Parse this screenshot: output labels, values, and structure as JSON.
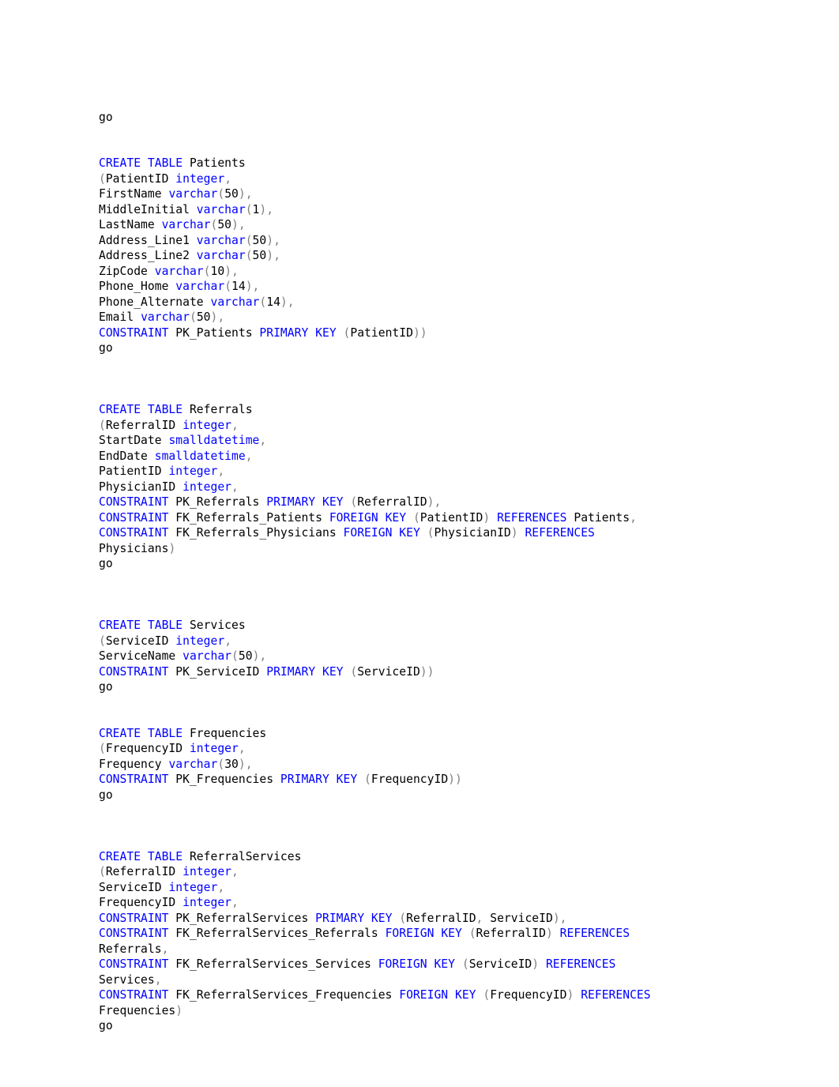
{
  "document": {
    "kind": "sql-script",
    "language": "SQL",
    "page_background": "#ffffff",
    "text_color": "#000000",
    "keyword_color": "#0000ff",
    "punctuation_color": "#808080",
    "tables": [
      "Patients",
      "Referrals",
      "Services",
      "Frequencies",
      "ReferralServices"
    ]
  },
  "code": {
    "lines": [
      [
        {
          "t": "go",
          "c": "plain"
        }
      ],
      [],
      [],
      [
        {
          "t": "CREATE",
          "c": "kw"
        },
        {
          "t": " ",
          "c": "plain"
        },
        {
          "t": "TABLE",
          "c": "kw"
        },
        {
          "t": " Patients",
          "c": "id"
        }
      ],
      [
        {
          "t": "(",
          "c": "pun"
        },
        {
          "t": "PatientID ",
          "c": "id"
        },
        {
          "t": "integer",
          "c": "typ"
        },
        {
          "t": ",",
          "c": "pun"
        }
      ],
      [
        {
          "t": "FirstName ",
          "c": "id"
        },
        {
          "t": "varchar",
          "c": "typ"
        },
        {
          "t": "(",
          "c": "pun"
        },
        {
          "t": "50",
          "c": "num"
        },
        {
          "t": "),",
          "c": "pun"
        }
      ],
      [
        {
          "t": "MiddleInitial ",
          "c": "id"
        },
        {
          "t": "varchar",
          "c": "typ"
        },
        {
          "t": "(",
          "c": "pun"
        },
        {
          "t": "1",
          "c": "num"
        },
        {
          "t": "),",
          "c": "pun"
        }
      ],
      [
        {
          "t": "LastName ",
          "c": "id"
        },
        {
          "t": "varchar",
          "c": "typ"
        },
        {
          "t": "(",
          "c": "pun"
        },
        {
          "t": "50",
          "c": "num"
        },
        {
          "t": "),",
          "c": "pun"
        }
      ],
      [
        {
          "t": "Address_Line1 ",
          "c": "id"
        },
        {
          "t": "varchar",
          "c": "typ"
        },
        {
          "t": "(",
          "c": "pun"
        },
        {
          "t": "50",
          "c": "num"
        },
        {
          "t": "),",
          "c": "pun"
        }
      ],
      [
        {
          "t": "Address_Line2 ",
          "c": "id"
        },
        {
          "t": "varchar",
          "c": "typ"
        },
        {
          "t": "(",
          "c": "pun"
        },
        {
          "t": "50",
          "c": "num"
        },
        {
          "t": "),",
          "c": "pun"
        }
      ],
      [
        {
          "t": "ZipCode ",
          "c": "id"
        },
        {
          "t": "varchar",
          "c": "typ"
        },
        {
          "t": "(",
          "c": "pun"
        },
        {
          "t": "10",
          "c": "num"
        },
        {
          "t": "),",
          "c": "pun"
        }
      ],
      [
        {
          "t": "Phone_Home ",
          "c": "id"
        },
        {
          "t": "varchar",
          "c": "typ"
        },
        {
          "t": "(",
          "c": "pun"
        },
        {
          "t": "14",
          "c": "num"
        },
        {
          "t": "),",
          "c": "pun"
        }
      ],
      [
        {
          "t": "Phone_Alternate ",
          "c": "id"
        },
        {
          "t": "varchar",
          "c": "typ"
        },
        {
          "t": "(",
          "c": "pun"
        },
        {
          "t": "14",
          "c": "num"
        },
        {
          "t": "),",
          "c": "pun"
        }
      ],
      [
        {
          "t": "Email ",
          "c": "id"
        },
        {
          "t": "varchar",
          "c": "typ"
        },
        {
          "t": "(",
          "c": "pun"
        },
        {
          "t": "50",
          "c": "num"
        },
        {
          "t": "),",
          "c": "pun"
        }
      ],
      [
        {
          "t": "CONSTRAINT",
          "c": "kw"
        },
        {
          "t": " PK_Patients ",
          "c": "id"
        },
        {
          "t": "PRIMARY",
          "c": "kw"
        },
        {
          "t": " ",
          "c": "plain"
        },
        {
          "t": "KEY",
          "c": "kw"
        },
        {
          "t": " ",
          "c": "plain"
        },
        {
          "t": "(",
          "c": "pun"
        },
        {
          "t": "PatientID",
          "c": "id"
        },
        {
          "t": "))",
          "c": "pun"
        }
      ],
      [
        {
          "t": "go",
          "c": "plain"
        }
      ],
      [],
      [],
      [],
      [
        {
          "t": "CREATE",
          "c": "kw"
        },
        {
          "t": " ",
          "c": "plain"
        },
        {
          "t": "TABLE",
          "c": "kw"
        },
        {
          "t": " Referrals",
          "c": "id"
        }
      ],
      [
        {
          "t": "(",
          "c": "pun"
        },
        {
          "t": "ReferralID ",
          "c": "id"
        },
        {
          "t": "integer",
          "c": "typ"
        },
        {
          "t": ",",
          "c": "pun"
        }
      ],
      [
        {
          "t": "StartDate ",
          "c": "id"
        },
        {
          "t": "smalldatetime",
          "c": "typ"
        },
        {
          "t": ",",
          "c": "pun"
        }
      ],
      [
        {
          "t": "EndDate ",
          "c": "id"
        },
        {
          "t": "smalldatetime",
          "c": "typ"
        },
        {
          "t": ",",
          "c": "pun"
        }
      ],
      [
        {
          "t": "PatientID ",
          "c": "id"
        },
        {
          "t": "integer",
          "c": "typ"
        },
        {
          "t": ",",
          "c": "pun"
        }
      ],
      [
        {
          "t": "PhysicianID ",
          "c": "id"
        },
        {
          "t": "integer",
          "c": "typ"
        },
        {
          "t": ",",
          "c": "pun"
        }
      ],
      [
        {
          "t": "CONSTRAINT",
          "c": "kw"
        },
        {
          "t": " PK_Referrals ",
          "c": "id"
        },
        {
          "t": "PRIMARY",
          "c": "kw"
        },
        {
          "t": " ",
          "c": "plain"
        },
        {
          "t": "KEY",
          "c": "kw"
        },
        {
          "t": " ",
          "c": "plain"
        },
        {
          "t": "(",
          "c": "pun"
        },
        {
          "t": "ReferralID",
          "c": "id"
        },
        {
          "t": "),",
          "c": "pun"
        }
      ],
      [
        {
          "t": "CONSTRAINT",
          "c": "kw"
        },
        {
          "t": " FK_Referrals_Patients ",
          "c": "id"
        },
        {
          "t": "FOREIGN",
          "c": "kw"
        },
        {
          "t": " ",
          "c": "plain"
        },
        {
          "t": "KEY",
          "c": "kw"
        },
        {
          "t": " ",
          "c": "plain"
        },
        {
          "t": "(",
          "c": "pun"
        },
        {
          "t": "PatientID",
          "c": "id"
        },
        {
          "t": ")",
          "c": "pun"
        },
        {
          "t": " ",
          "c": "plain"
        },
        {
          "t": "REFERENCES",
          "c": "kw"
        },
        {
          "t": " Patients",
          "c": "id"
        },
        {
          "t": ",",
          "c": "pun"
        }
      ],
      [
        {
          "t": "CONSTRAINT",
          "c": "kw"
        },
        {
          "t": " FK_Referrals_Physicians ",
          "c": "id"
        },
        {
          "t": "FOREIGN",
          "c": "kw"
        },
        {
          "t": " ",
          "c": "plain"
        },
        {
          "t": "KEY",
          "c": "kw"
        },
        {
          "t": " ",
          "c": "plain"
        },
        {
          "t": "(",
          "c": "pun"
        },
        {
          "t": "PhysicianID",
          "c": "id"
        },
        {
          "t": ")",
          "c": "pun"
        },
        {
          "t": " ",
          "c": "plain"
        },
        {
          "t": "REFERENCES",
          "c": "kw"
        }
      ],
      [
        {
          "t": "Physicians",
          "c": "id"
        },
        {
          "t": ")",
          "c": "pun"
        }
      ],
      [
        {
          "t": "go",
          "c": "plain"
        }
      ],
      [],
      [],
      [],
      [
        {
          "t": "CREATE",
          "c": "kw"
        },
        {
          "t": " ",
          "c": "plain"
        },
        {
          "t": "TABLE",
          "c": "kw"
        },
        {
          "t": " Services",
          "c": "id"
        }
      ],
      [
        {
          "t": "(",
          "c": "pun"
        },
        {
          "t": "ServiceID ",
          "c": "id"
        },
        {
          "t": "integer",
          "c": "typ"
        },
        {
          "t": ",",
          "c": "pun"
        }
      ],
      [
        {
          "t": "ServiceName ",
          "c": "id"
        },
        {
          "t": "varchar",
          "c": "typ"
        },
        {
          "t": "(",
          "c": "pun"
        },
        {
          "t": "50",
          "c": "num"
        },
        {
          "t": "),",
          "c": "pun"
        }
      ],
      [
        {
          "t": "CONSTRAINT",
          "c": "kw"
        },
        {
          "t": " PK_ServiceID ",
          "c": "id"
        },
        {
          "t": "PRIMARY",
          "c": "kw"
        },
        {
          "t": " ",
          "c": "plain"
        },
        {
          "t": "KEY",
          "c": "kw"
        },
        {
          "t": " ",
          "c": "plain"
        },
        {
          "t": "(",
          "c": "pun"
        },
        {
          "t": "ServiceID",
          "c": "id"
        },
        {
          "t": "))",
          "c": "pun"
        }
      ],
      [
        {
          "t": "go",
          "c": "plain"
        }
      ],
      [],
      [],
      [
        {
          "t": "CREATE",
          "c": "kw"
        },
        {
          "t": " ",
          "c": "plain"
        },
        {
          "t": "TABLE",
          "c": "kw"
        },
        {
          "t": " Frequencies",
          "c": "id"
        }
      ],
      [
        {
          "t": "(",
          "c": "pun"
        },
        {
          "t": "FrequencyID ",
          "c": "id"
        },
        {
          "t": "integer",
          "c": "typ"
        },
        {
          "t": ",",
          "c": "pun"
        }
      ],
      [
        {
          "t": "Frequency ",
          "c": "id"
        },
        {
          "t": "varchar",
          "c": "typ"
        },
        {
          "t": "(",
          "c": "pun"
        },
        {
          "t": "30",
          "c": "num"
        },
        {
          "t": "),",
          "c": "pun"
        }
      ],
      [
        {
          "t": "CONSTRAINT",
          "c": "kw"
        },
        {
          "t": " PK_Frequencies ",
          "c": "id"
        },
        {
          "t": "PRIMARY",
          "c": "kw"
        },
        {
          "t": " ",
          "c": "plain"
        },
        {
          "t": "KEY",
          "c": "kw"
        },
        {
          "t": " ",
          "c": "plain"
        },
        {
          "t": "(",
          "c": "pun"
        },
        {
          "t": "FrequencyID",
          "c": "id"
        },
        {
          "t": "))",
          "c": "pun"
        }
      ],
      [
        {
          "t": "go",
          "c": "plain"
        }
      ],
      [],
      [],
      [],
      [
        {
          "t": "CREATE",
          "c": "kw"
        },
        {
          "t": " ",
          "c": "plain"
        },
        {
          "t": "TABLE",
          "c": "kw"
        },
        {
          "t": " ReferralServices",
          "c": "id"
        }
      ],
      [
        {
          "t": "(",
          "c": "pun"
        },
        {
          "t": "ReferralID ",
          "c": "id"
        },
        {
          "t": "integer",
          "c": "typ"
        },
        {
          "t": ",",
          "c": "pun"
        }
      ],
      [
        {
          "t": "ServiceID ",
          "c": "id"
        },
        {
          "t": "integer",
          "c": "typ"
        },
        {
          "t": ",",
          "c": "pun"
        }
      ],
      [
        {
          "t": "FrequencyID ",
          "c": "id"
        },
        {
          "t": "integer",
          "c": "typ"
        },
        {
          "t": ",",
          "c": "pun"
        }
      ],
      [
        {
          "t": "CONSTRAINT",
          "c": "kw"
        },
        {
          "t": " PK_ReferralServices ",
          "c": "id"
        },
        {
          "t": "PRIMARY",
          "c": "kw"
        },
        {
          "t": " ",
          "c": "plain"
        },
        {
          "t": "KEY",
          "c": "kw"
        },
        {
          "t": " ",
          "c": "plain"
        },
        {
          "t": "(",
          "c": "pun"
        },
        {
          "t": "ReferralID",
          "c": "id"
        },
        {
          "t": ", ",
          "c": "pun"
        },
        {
          "t": "ServiceID",
          "c": "id"
        },
        {
          "t": "),",
          "c": "pun"
        }
      ],
      [
        {
          "t": "CONSTRAINT",
          "c": "kw"
        },
        {
          "t": " FK_ReferralServices_Referrals ",
          "c": "id"
        },
        {
          "t": "FOREIGN",
          "c": "kw"
        },
        {
          "t": " ",
          "c": "plain"
        },
        {
          "t": "KEY",
          "c": "kw"
        },
        {
          "t": " ",
          "c": "plain"
        },
        {
          "t": "(",
          "c": "pun"
        },
        {
          "t": "ReferralID",
          "c": "id"
        },
        {
          "t": ")",
          "c": "pun"
        },
        {
          "t": " ",
          "c": "plain"
        },
        {
          "t": "REFERENCES",
          "c": "kw"
        }
      ],
      [
        {
          "t": "Referrals",
          "c": "id"
        },
        {
          "t": ",",
          "c": "pun"
        }
      ],
      [
        {
          "t": "CONSTRAINT",
          "c": "kw"
        },
        {
          "t": " FK_ReferralServices_Services ",
          "c": "id"
        },
        {
          "t": "FOREIGN",
          "c": "kw"
        },
        {
          "t": " ",
          "c": "plain"
        },
        {
          "t": "KEY",
          "c": "kw"
        },
        {
          "t": " ",
          "c": "plain"
        },
        {
          "t": "(",
          "c": "pun"
        },
        {
          "t": "ServiceID",
          "c": "id"
        },
        {
          "t": ")",
          "c": "pun"
        },
        {
          "t": " ",
          "c": "plain"
        },
        {
          "t": "REFERENCES",
          "c": "kw"
        }
      ],
      [
        {
          "t": "Services",
          "c": "id"
        },
        {
          "t": ",",
          "c": "pun"
        }
      ],
      [
        {
          "t": "CONSTRAINT",
          "c": "kw"
        },
        {
          "t": " FK_ReferralServices_Frequencies ",
          "c": "id"
        },
        {
          "t": "FOREIGN",
          "c": "kw"
        },
        {
          "t": " ",
          "c": "plain"
        },
        {
          "t": "KEY",
          "c": "kw"
        },
        {
          "t": " ",
          "c": "plain"
        },
        {
          "t": "(",
          "c": "pun"
        },
        {
          "t": "FrequencyID",
          "c": "id"
        },
        {
          "t": ")",
          "c": "pun"
        },
        {
          "t": " ",
          "c": "plain"
        },
        {
          "t": "REFERENCES",
          "c": "kw"
        }
      ],
      [
        {
          "t": "Frequencies",
          "c": "id"
        },
        {
          "t": ")",
          "c": "pun"
        }
      ],
      [
        {
          "t": "go",
          "c": "plain"
        }
      ]
    ]
  }
}
